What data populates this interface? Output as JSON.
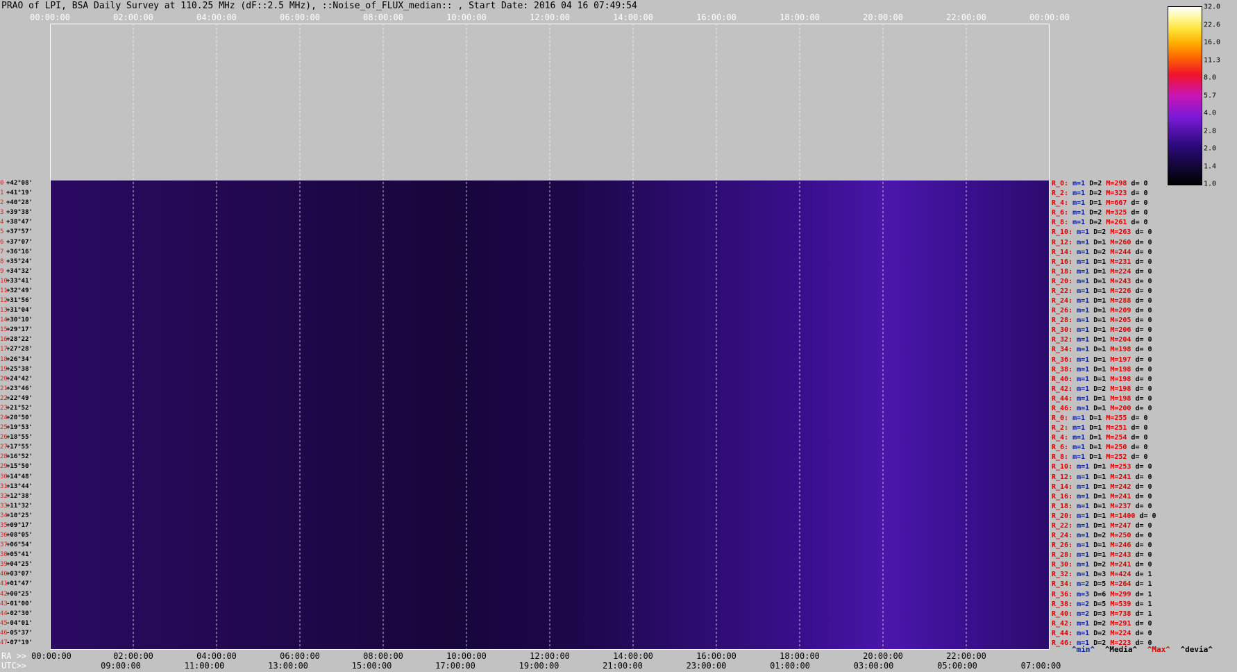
{
  "title": "PRAO of LPI, BSA Daily Survey at 110.25 MHz (dF::2.5 MHz), ::Noise_of_FLUX_median:: , Start Date: 2016 04 16 07:49:54",
  "chart_data": {
    "type": "heatmap",
    "x_ticks": [
      "00:00:00",
      "02:00:00",
      "04:00:00",
      "06:00:00",
      "08:00:00",
      "10:00:00",
      "12:00:00",
      "14:00:00",
      "16:00:00",
      "18:00:00",
      "20:00:00",
      "22:00:00",
      "00:00:00"
    ],
    "ra_label": "RA >>",
    "utc_label": "UTC>>",
    "utc_ticks": [
      "09:00:00",
      "11:00:00",
      "13:00:00",
      "15:00:00",
      "17:00:00",
      "19:00:00",
      "21:00:00",
      "23:00:00",
      "01:00:00",
      "03:00:00",
      "05:00:00",
      "07:00:00"
    ],
    "declinations": [
      "+42°08'",
      "+41°19'",
      "+40°28'",
      "+39°38'",
      "+38°47'",
      "+37°57'",
      "+37°07'",
      "+36°16'",
      "+35°24'",
      "+34°32'",
      "+33°41'",
      "+32°49'",
      "+31°56'",
      "+31°04'",
      "+30°10'",
      "+29°17'",
      "+28°22'",
      "+27°28'",
      "+26°34'",
      "+25°38'",
      "+24°42'",
      "+23°46'",
      "+22°49'",
      "+21°52'",
      "+20°50'",
      "+19°53'",
      "+18°55'",
      "+17°55'",
      "+16°52'",
      "+15°50'",
      "+14°48'",
      "+13°44'",
      "+12°38'",
      "+11°32'",
      "+10°25'",
      "+09°17'",
      "+08°05'",
      "+06°54'",
      "+05°41'",
      "+04°25'",
      "+03°07'",
      "+01°47'",
      "+00°25'",
      "-01°00'",
      "-02°30'",
      "-04°01'",
      "-05°37'",
      "-07°19'"
    ],
    "beam_indices": [
      "0",
      "1",
      "2",
      "3",
      "4",
      "5",
      "6",
      "7",
      "8",
      "9",
      "10",
      "11",
      "12",
      "13",
      "14",
      "15",
      "16",
      "17",
      "18",
      "19",
      "20",
      "21",
      "22",
      "23",
      "24",
      "25",
      "26",
      "27",
      "28",
      "29",
      "30",
      "31",
      "32",
      "33",
      "34",
      "35",
      "36",
      "37",
      "38",
      "39",
      "40",
      "41",
      "42",
      "43",
      "44",
      "45",
      "46",
      "47"
    ],
    "antennas": [
      {
        "r": "R_0:",
        "m": "m=1",
        "d": "D=2",
        "M": "M=298",
        "e": "d= 0"
      },
      {
        "r": "R_2:",
        "m": "m=1",
        "d": "D=2",
        "M": "M=323",
        "e": "d= 0"
      },
      {
        "r": "R_4:",
        "m": "m=1",
        "d": "D=1",
        "M": "M=667",
        "e": "d= 0"
      },
      {
        "r": "R_6:",
        "m": "m=1",
        "d": "D=2",
        "M": "M=325",
        "e": "d= 0"
      },
      {
        "r": "R_8:",
        "m": "m=1",
        "d": "D=2",
        "M": "M=261",
        "e": "d= 0"
      },
      {
        "r": "R_10:",
        "m": "m=1",
        "d": "D=2",
        "M": "M=263",
        "e": "d= 0"
      },
      {
        "r": "R_12:",
        "m": "m=1",
        "d": "D=1",
        "M": "M=260",
        "e": "d= 0"
      },
      {
        "r": "R_14:",
        "m": "m=1",
        "d": "D=2",
        "M": "M=244",
        "e": "d= 0"
      },
      {
        "r": "R_16:",
        "m": "m=1",
        "d": "D=1",
        "M": "M=231",
        "e": "d= 0"
      },
      {
        "r": "R_18:",
        "m": "m=1",
        "d": "D=1",
        "M": "M=224",
        "e": "d= 0"
      },
      {
        "r": "R_20:",
        "m": "m=1",
        "d": "D=1",
        "M": "M=243",
        "e": "d= 0"
      },
      {
        "r": "R_22:",
        "m": "m=1",
        "d": "D=1",
        "M": "M=226",
        "e": "d= 0"
      },
      {
        "r": "R_24:",
        "m": "m=1",
        "d": "D=1",
        "M": "M=288",
        "e": "d= 0"
      },
      {
        "r": "R_26:",
        "m": "m=1",
        "d": "D=1",
        "M": "M=209",
        "e": "d= 0"
      },
      {
        "r": "R_28:",
        "m": "m=1",
        "d": "D=1",
        "M": "M=205",
        "e": "d= 0"
      },
      {
        "r": "R_30:",
        "m": "m=1",
        "d": "D=1",
        "M": "M=206",
        "e": "d= 0"
      },
      {
        "r": "R_32:",
        "m": "m=1",
        "d": "D=1",
        "M": "M=204",
        "e": "d= 0"
      },
      {
        "r": "R_34:",
        "m": "m=1",
        "d": "D=1",
        "M": "M=198",
        "e": "d= 0"
      },
      {
        "r": "R_36:",
        "m": "m=1",
        "d": "D=1",
        "M": "M=197",
        "e": "d= 0"
      },
      {
        "r": "R_38:",
        "m": "m=1",
        "d": "D=1",
        "M": "M=198",
        "e": "d= 0"
      },
      {
        "r": "R_40:",
        "m": "m=1",
        "d": "D=1",
        "M": "M=198",
        "e": "d= 0"
      },
      {
        "r": "R_42:",
        "m": "m=1",
        "d": "D=2",
        "M": "M=198",
        "e": "d= 0"
      },
      {
        "r": "R_44:",
        "m": "m=1",
        "d": "D=1",
        "M": "M=198",
        "e": "d= 0"
      },
      {
        "r": "R_46:",
        "m": "m=1",
        "d": "D=1",
        "M": "M=200",
        "e": "d= 0"
      },
      {
        "r": "R_0:",
        "m": "m=1",
        "d": "D=1",
        "M": "M=255",
        "e": "d= 0"
      },
      {
        "r": "R_2:",
        "m": "m=1",
        "d": "D=1",
        "M": "M=251",
        "e": "d= 0"
      },
      {
        "r": "R_4:",
        "m": "m=1",
        "d": "D=1",
        "M": "M=254",
        "e": "d= 0"
      },
      {
        "r": "R_6:",
        "m": "m=1",
        "d": "D=1",
        "M": "M=250",
        "e": "d= 0"
      },
      {
        "r": "R_8:",
        "m": "m=1",
        "d": "D=1",
        "M": "M=252",
        "e": "d= 0"
      },
      {
        "r": "R_10:",
        "m": "m=1",
        "d": "D=1",
        "M": "M=253",
        "e": "d= 0"
      },
      {
        "r": "R_12:",
        "m": "m=1",
        "d": "D=1",
        "M": "M=241",
        "e": "d= 0"
      },
      {
        "r": "R_14:",
        "m": "m=1",
        "d": "D=1",
        "M": "M=242",
        "e": "d= 0"
      },
      {
        "r": "R_16:",
        "m": "m=1",
        "d": "D=1",
        "M": "M=241",
        "e": "d= 0"
      },
      {
        "r": "R_18:",
        "m": "m=1",
        "d": "D=1",
        "M": "M=237",
        "e": "d= 0"
      },
      {
        "r": "R_20:",
        "m": "m=1",
        "d": "D=1",
        "M": "M=1400",
        "e": "d= 0"
      },
      {
        "r": "R_22:",
        "m": "m=1",
        "d": "D=1",
        "M": "M=247",
        "e": "d= 0"
      },
      {
        "r": "R_24:",
        "m": "m=1",
        "d": "D=2",
        "M": "M=250",
        "e": "d= 0"
      },
      {
        "r": "R_26:",
        "m": "m=1",
        "d": "D=1",
        "M": "M=246",
        "e": "d= 0"
      },
      {
        "r": "R_28:",
        "m": "m=1",
        "d": "D=1",
        "M": "M=243",
        "e": "d= 0"
      },
      {
        "r": "R_30:",
        "m": "m=1",
        "d": "D=2",
        "M": "M=241",
        "e": "d= 0"
      },
      {
        "r": "R_32:",
        "m": "m=1",
        "d": "D=3",
        "M": "M=424",
        "e": "d= 1"
      },
      {
        "r": "R_34:",
        "m": "m=2",
        "d": "D=5",
        "M": "M=264",
        "e": "d= 1"
      },
      {
        "r": "R_36:",
        "m": "m=3",
        "d": "D=6",
        "M": "M=299",
        "e": "d= 1"
      },
      {
        "r": "R_38:",
        "m": "m=2",
        "d": "D=5",
        "M": "M=539",
        "e": "d= 1"
      },
      {
        "r": "R_40:",
        "m": "m=2",
        "d": "D=3",
        "M": "M=738",
        "e": "d= 1"
      },
      {
        "r": "R_42:",
        "m": "m=1",
        "d": "D=2",
        "M": "M=291",
        "e": "d= 0"
      },
      {
        "r": "R_44:",
        "m": "m=1",
        "d": "D=2",
        "M": "M=224",
        "e": "d= 0"
      },
      {
        "r": "R_46:",
        "m": "m=1",
        "d": "D=2",
        "M": "M=223",
        "e": "d= 0"
      }
    ],
    "colorbar": {
      "ticks": [
        "32.0",
        "22.6",
        "16.0",
        "11.3",
        "8.0",
        "5.7",
        "4.0",
        "2.8",
        "2.0",
        "1.4",
        "1.0"
      ],
      "range": [
        1.0,
        32.0
      ],
      "scale": "log"
    },
    "legend": {
      "min": "^min^",
      "media": "^Media^",
      "max": "^Max^",
      "devia": "^devia^"
    },
    "colors": {
      "min": "#0a2290",
      "media": "#000000",
      "max": "#d00000",
      "devia": "#000000"
    },
    "grid": true
  }
}
